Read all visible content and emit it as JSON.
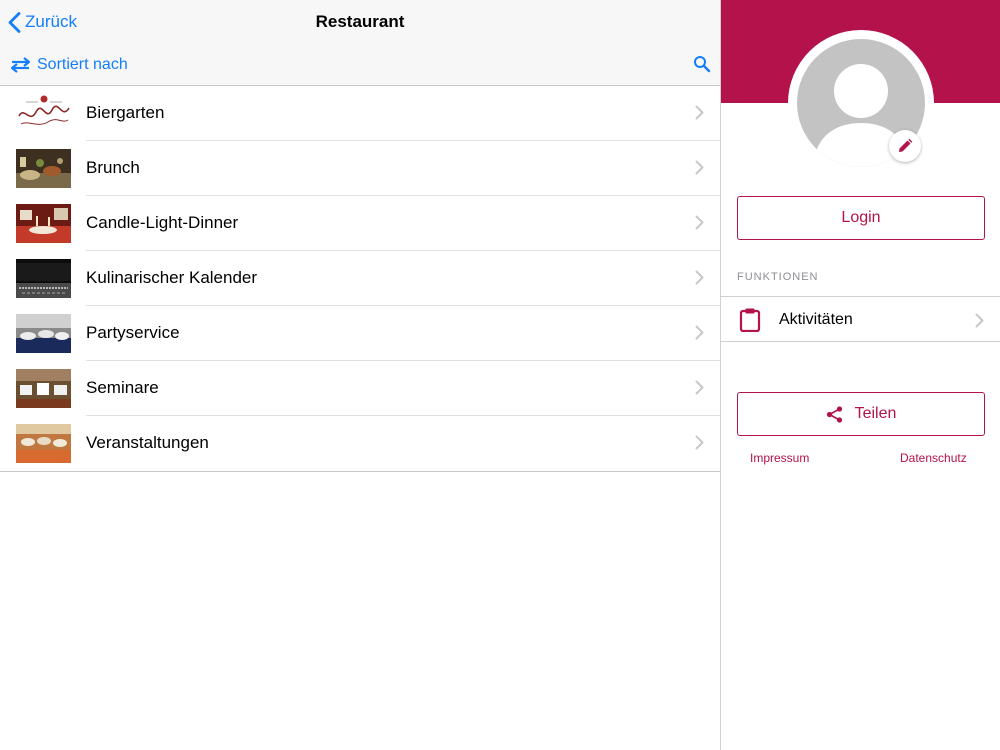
{
  "navbar": {
    "back_label": "Zurück",
    "title": "Restaurant",
    "sort_label": "Sortiert nach"
  },
  "list": {
    "items": [
      {
        "label": "Biergarten",
        "thumb": "biergarten-logo"
      },
      {
        "label": "Brunch",
        "thumb": "brunch-photo"
      },
      {
        "label": "Candle-Light-Dinner",
        "thumb": "candle-light-photo"
      },
      {
        "label": "Kulinarischer Kalender",
        "thumb": "kalender-photo"
      },
      {
        "label": "Partyservice",
        "thumb": "partyservice-photo"
      },
      {
        "label": "Seminare",
        "thumb": "seminare-photo"
      },
      {
        "label": "Veranstaltungen",
        "thumb": "veranstaltungen-photo"
      }
    ]
  },
  "sidebar": {
    "login_label": "Login",
    "section_title": "FUNKTIONEN",
    "functions": [
      {
        "label": "Aktivitäten",
        "icon": "clipboard-icon"
      }
    ],
    "share_label": "Teilen",
    "links": {
      "impressum": "Impressum",
      "datenschutz": "Datenschutz"
    }
  },
  "colors": {
    "ios_blue": "#147efb",
    "brand": "#b3124a"
  },
  "icons": [
    "chevron-left-icon",
    "swap-arrows-icon",
    "search-icon",
    "chevron-right-icon",
    "pencil-icon",
    "share-icon",
    "clipboard-icon",
    "avatar-placeholder-icon"
  ]
}
